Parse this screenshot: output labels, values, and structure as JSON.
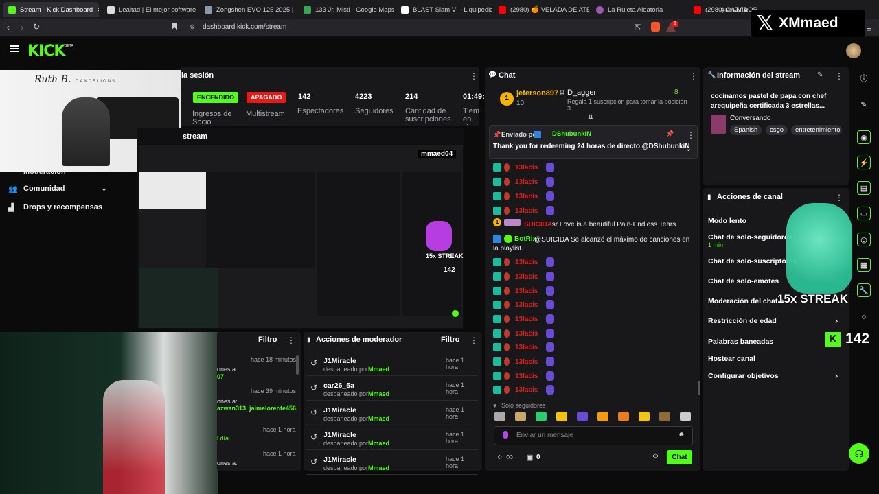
{
  "browser": {
    "tabs": [
      {
        "label": "Stream - Kick Dashboard",
        "color": "#53fc18"
      },
      {
        "label": "Lealtad | El mejor software para",
        "color": "#dddddd"
      },
      {
        "label": "Zongshen EVO 125 2025 | Prec",
        "color": "#8899aa"
      },
      {
        "label": "133 Jr. Misti - Google Maps",
        "color": "#34a853"
      },
      {
        "label": "BLAST Slam VI - Liquipedia Do",
        "color": "#ffffff"
      },
      {
        "label": "(2980) 🍊 VELADA DE ATE: ¡AR",
        "color": "#ff0000"
      },
      {
        "label": "La Ruleta Aleatoria",
        "color": "#9b59b6"
      },
      {
        "label": "(2980) CAZADOR DE",
        "color": "#ff0000"
      }
    ],
    "url": "dashboard.kick.com/stream",
    "ext_badge": "1",
    "fps_text": "FPS N/A"
  },
  "watermark": {
    "brand": "XMmaed"
  },
  "kick": {
    "logo": "KICK",
    "beta": "BETA"
  },
  "session": {
    "title": "la sesión",
    "status_on": "ENCENDIDO",
    "status_off": "APAGADO",
    "labels": [
      "Ingresos de Socio",
      "Multistream",
      "Espectadores",
      "Seguidores",
      "Cantidad de suscripciones",
      "Tiempo en vivo"
    ],
    "values": [
      "142",
      "4223",
      "214",
      "01:49:"
    ]
  },
  "nav": {
    "moderation": "Moderación",
    "community": "Comunidad",
    "drops": "Drops y recompensas"
  },
  "stream_panel": {
    "title": "stream",
    "handle": "mmaed04",
    "streak": "15x STREAK",
    "viewers": "142"
  },
  "album": {
    "artist": "Ruth B.",
    "album": "DANDELIONS"
  },
  "activity": {
    "filter": "Filtro",
    "times": [
      "hace 18 minutos",
      "hace 39 minutos",
      "hace 1 hora",
      "hace 1 hora"
    ],
    "snippets": [
      "ones a:",
      "07",
      "ones a:",
      "azwan313, jaimelorente456,",
      "l día",
      "ones a:"
    ]
  },
  "modactions": {
    "title": "Acciones de moderador",
    "filter": "Filtro",
    "rows": [
      {
        "user": "J1Miracle",
        "action": "desbaneado por",
        "by": "Mmaed",
        "time": "hace 1 hora"
      },
      {
        "user": "car26_5a",
        "action": "desbaneado por",
        "by": "Mmaed",
        "time": "hace 1 hora"
      },
      {
        "user": "J1Miracle",
        "action": "desbaneado por",
        "by": "Mmaed",
        "time": "hace 1 hora"
      },
      {
        "user": "J1Miracle",
        "action": "desbaneado por",
        "by": "Mmaed",
        "time": "hace 1 hora"
      },
      {
        "user": "J1Miracle",
        "action": "desbaneado por",
        "by": "Mmaed",
        "time": "hace 1 hora"
      }
    ]
  },
  "chat": {
    "title": "Chat",
    "top_user": "jeferson897",
    "top_rank": "1",
    "top_count": "10",
    "sub_user": "D_agger",
    "sub_count": "8",
    "sub_text": "Regala 1 suscripción para tomar la posición 3",
    "pinned_label": "Enviado por",
    "pinned_by": "DShubunkiN",
    "pinned_msg": "Thank you for redeeming 24 horas de directo @DShubunkiN",
    "repeat_user": "13lacis",
    "msg_suicida_user": "SUICIDA",
    "msg_suicida_text": "!sr Love is a beautiful Pain-Endless Tears",
    "bot_user": "BotRix",
    "bot_text": "@SUICIDA Se alcanzó el máximo de canciones en la playlist.",
    "followers_only": "Solo seguidores",
    "input_placeholder": "Enviar un mensaje",
    "infinite": "∞",
    "gift_count": "0",
    "send": "Chat"
  },
  "info": {
    "title": "Información del stream",
    "stream_title": "cocinamos pastel de papa con chef arequipeña certificada 3 estrellas...",
    "category": "Conversando",
    "tags": [
      "Spanish",
      "csgo",
      "entretenimiento"
    ]
  },
  "channel_actions": {
    "title": "Acciones de canal",
    "items": [
      "Modo lento",
      "Chat de solo-seguidores",
      "Chat de solo-suscriptores",
      "Chat de solo-emotes",
      "Moderación del chat con",
      "Restricción de edad",
      "Palabras baneadas",
      "Hostear canal",
      "Configurar objetivos"
    ],
    "followers_dur": "1 min"
  },
  "overlay": {
    "streak": "15x STREAK",
    "viewers": "142"
  },
  "colors": {
    "accent": "#53fc18",
    "panel": "#18181b",
    "bg": "#0b0b0c",
    "red": "#e91916"
  }
}
